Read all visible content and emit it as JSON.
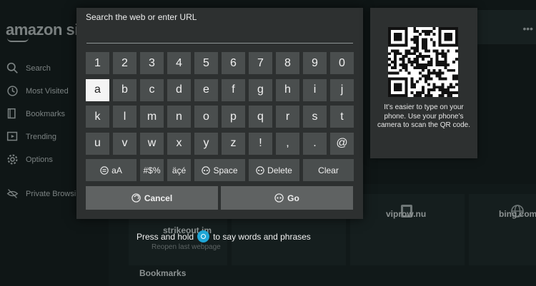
{
  "background": {
    "logo_text": "amazon si",
    "nav": [
      {
        "label": "Search",
        "icon": "search-icon"
      },
      {
        "label": "Most Visited",
        "icon": "history-icon"
      },
      {
        "label": "Bookmarks",
        "icon": "bookmark-icon"
      },
      {
        "label": "Trending",
        "icon": "trending-icon"
      },
      {
        "label": "Options",
        "icon": "gear-icon"
      },
      {
        "label": "Private Browsi",
        "icon": "private-eye-icon"
      }
    ],
    "tiles": [
      "strikeout.im",
      "viprow.nu",
      "bing.com"
    ],
    "reopen_text": "Reopen last webpage",
    "bookmarks_heading": "Bookmarks"
  },
  "keyboard": {
    "title": "Search the web or enter URL",
    "input_value": "",
    "rows": [
      [
        "1",
        "2",
        "3",
        "4",
        "5",
        "6",
        "7",
        "8",
        "9",
        "0"
      ],
      [
        "a",
        "b",
        "c",
        "d",
        "e",
        "f",
        "g",
        "h",
        "i",
        "j"
      ],
      [
        "k",
        "l",
        "m",
        "n",
        "o",
        "p",
        "q",
        "r",
        "s",
        "t"
      ],
      [
        "u",
        "v",
        "w",
        "x",
        "y",
        "z",
        "!",
        ",",
        ".",
        "@"
      ]
    ],
    "selected_key": "a",
    "special_row": {
      "case_toggle": "aA",
      "symbols": "#$%",
      "accents": "äçé",
      "space": "Space",
      "delete": "Delete",
      "clear": "Clear"
    },
    "cancel_label": "Cancel",
    "go_label": "Go"
  },
  "qr": {
    "hint": "It’s easier to type on your phone. Use your phone’s camera to scan the QR code."
  },
  "voice_hint": {
    "before": "Press and hold",
    "after": "to say words and phrases"
  },
  "colors": {
    "panel": "#2d3030",
    "key": "#4a4e4e",
    "key_selected": "#f4f4f4",
    "action_button": "#5f6262",
    "voice_accent": "#1fa6d6"
  }
}
